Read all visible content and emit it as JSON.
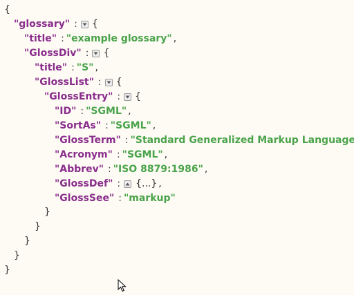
{
  "json": {
    "open_brace": "{",
    "close_brace": "}",
    "colon": ":",
    "comma": ",",
    "glossary_key": "\"glossary\"",
    "title_key": "\"title\"",
    "title_value": "\"example glossary\"",
    "glossdiv_key": "\"GlossDiv\"",
    "glossdiv_title_key": "\"title\"",
    "glossdiv_title_value": "\"S\"",
    "glosslist_key": "\"GlossList\"",
    "glossentry_key": "\"GlossEntry\"",
    "entries": [
      {
        "key": "\"ID\"",
        "value": "\"SGML\""
      },
      {
        "key": "\"SortAs\"",
        "value": "\"SGML\""
      },
      {
        "key": "\"GlossTerm\"",
        "value": "\"Standard Generalized Markup Language\""
      },
      {
        "key": "\"Acronym\"",
        "value": "\"SGML\""
      },
      {
        "key": "\"Abbrev\"",
        "value": "\"ISO 8879:1986\""
      }
    ],
    "glossdef_key": "\"GlossDef\"",
    "glossdef_collapsed": "{...}",
    "glosssee_key": "\"GlossSee\"",
    "glosssee_value": "\"markup\""
  },
  "icons": {
    "toggle_expanded": "collapse-toggle-icon",
    "toggle_collapsed": "expand-toggle-icon",
    "cursor": "mouse-pointer-icon"
  },
  "colors": {
    "background": "#fdfbf4",
    "key": "#8a2d8c",
    "string": "#4aa34a"
  }
}
